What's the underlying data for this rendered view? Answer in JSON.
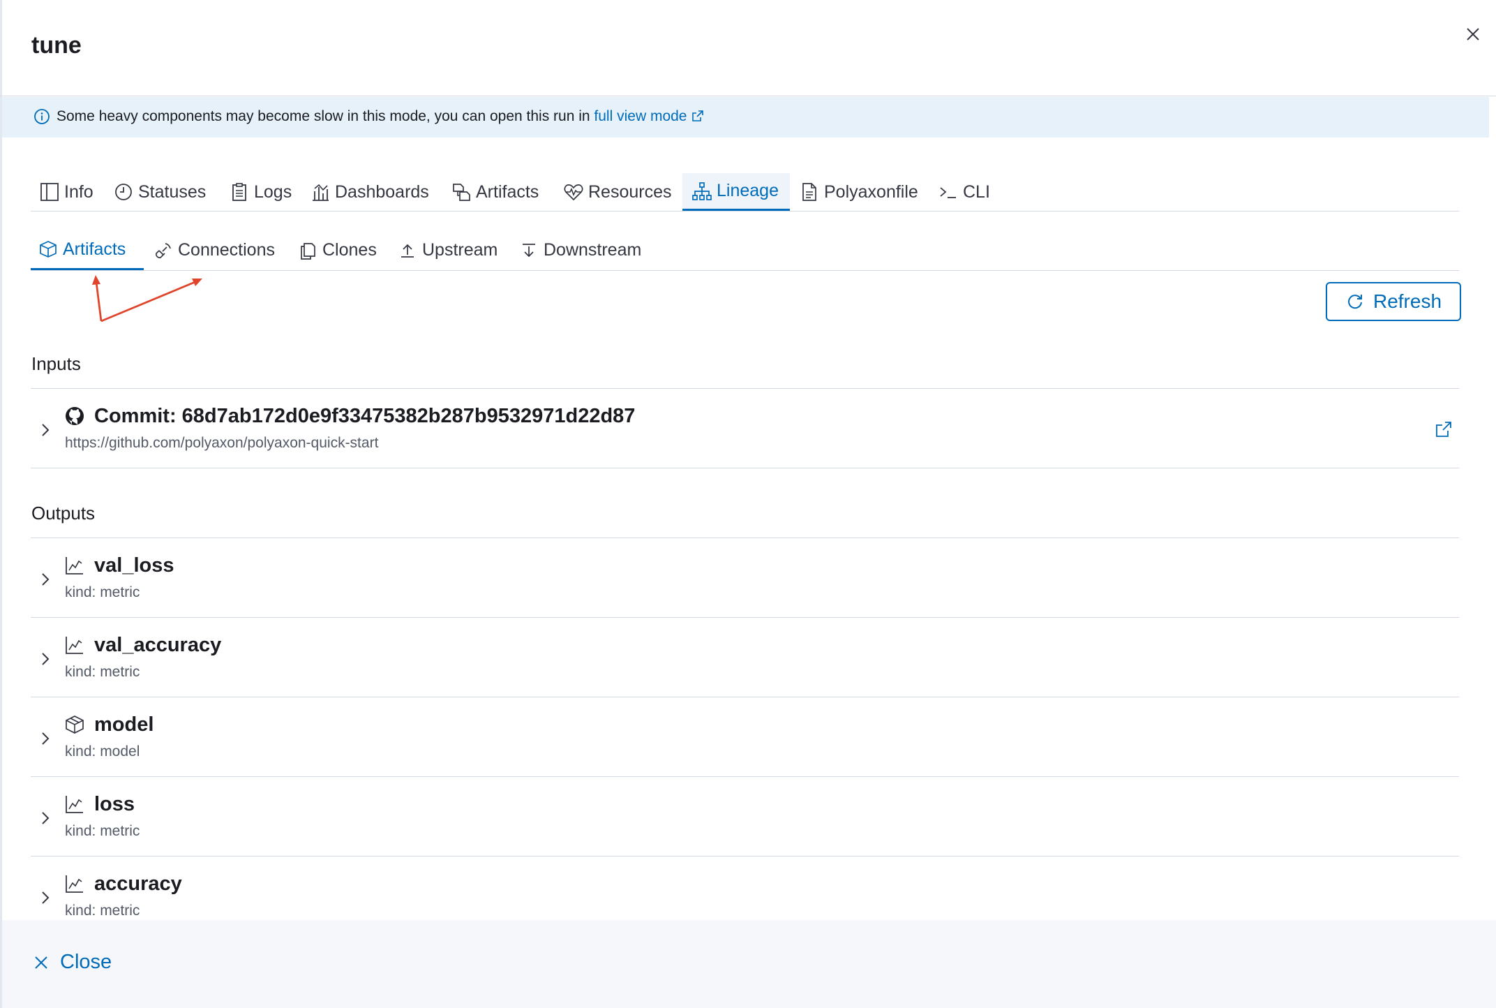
{
  "flyout": {
    "title": "tune",
    "close_icon": "close-icon"
  },
  "callout": {
    "message": "Some heavy components may become slow in this mode, you can open this run in",
    "link": "full view mode"
  },
  "tabs": [
    {
      "label": "Info",
      "icon": "info-panel-icon"
    },
    {
      "label": "Statuses",
      "icon": "clock-icon"
    },
    {
      "label": "Logs",
      "icon": "clipboard-icon"
    },
    {
      "label": "Dashboards",
      "icon": "dashboard-icon"
    },
    {
      "label": "Artifacts",
      "icon": "artifacts-icon"
    },
    {
      "label": "Resources",
      "icon": "heartbeat-icon"
    },
    {
      "label": "Lineage",
      "icon": "lineage-icon",
      "active": true
    },
    {
      "label": "Polyaxonfile",
      "icon": "document-icon"
    },
    {
      "label": "CLI",
      "icon": "terminal-icon"
    }
  ],
  "subtabs": [
    {
      "label": "Artifacts",
      "icon": "cube-icon",
      "active": true
    },
    {
      "label": "Connections",
      "icon": "connection-icon"
    },
    {
      "label": "Clones",
      "icon": "copy-icon"
    },
    {
      "label": "Upstream",
      "icon": "upload-icon"
    },
    {
      "label": "Downstream",
      "icon": "download-icon"
    }
  ],
  "refresh_label": "Refresh",
  "inputs": {
    "title": "Inputs",
    "items": [
      {
        "name": "Commit: 68d7ab172d0e9f33475382b287b9532971d22d87",
        "sub": "https://github.com/polyaxon/polyaxon-quick-start",
        "icon": "github-icon"
      }
    ]
  },
  "outputs": {
    "title": "Outputs",
    "items": [
      {
        "name": "val_loss",
        "sub": "kind: metric",
        "icon": "chart-line-icon"
      },
      {
        "name": "val_accuracy",
        "sub": "kind: metric",
        "icon": "chart-line-icon"
      },
      {
        "name": "model",
        "sub": "kind: model",
        "icon": "cube-icon"
      },
      {
        "name": "loss",
        "sub": "kind: metric",
        "icon": "chart-line-icon"
      },
      {
        "name": "accuracy",
        "sub": "kind: metric",
        "icon": "chart-line-icon"
      }
    ]
  },
  "footer": {
    "close_label": "Close"
  },
  "colors": {
    "accent": "#006bb8",
    "callout_bg": "#e6f1fa",
    "annotation_arrow": "#e0452b"
  }
}
